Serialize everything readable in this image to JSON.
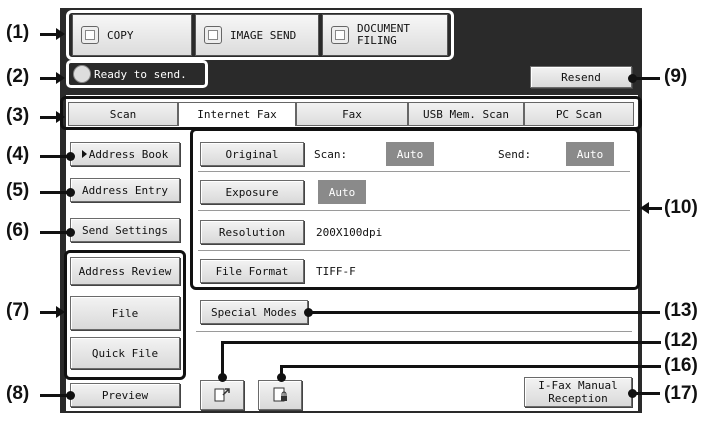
{
  "callouts": [
    "(1)",
    "(2)",
    "(3)",
    "(4)",
    "(5)",
    "(6)",
    "(7)",
    "(8)",
    "(9)",
    "(10)",
    "(13)",
    "(12)",
    "(16)",
    "(17)"
  ],
  "modes": [
    {
      "label": "COPY",
      "icon": "copy-icon"
    },
    {
      "label": "IMAGE SEND",
      "icon": "image-send-icon"
    },
    {
      "label": "DOCUMENT\nFILING",
      "icon": "document-filing-icon"
    }
  ],
  "status": {
    "text": "Ready to send.",
    "icon": "status-icon"
  },
  "resend_label": "Resend",
  "tabs": [
    "Scan",
    "Internet Fax",
    "Fax",
    "USB Mem. Scan",
    "PC Scan"
  ],
  "active_tab": "Internet Fax",
  "left_buttons": {
    "address_book": "Address Book",
    "address_entry": "Address Entry",
    "send_settings": "Send Settings",
    "address_review": "Address Review",
    "file": "File",
    "quick_file": "Quick File",
    "preview": "Preview"
  },
  "settings": {
    "original_label": "Original",
    "scan_label": "Scan:",
    "scan_value": "Auto",
    "send_label": "Send:",
    "send_value": "Auto",
    "exposure_label": "Exposure",
    "exposure_value": "Auto",
    "resolution_label": "Resolution",
    "resolution_value": "200X100dpi",
    "file_format_label": "File Format",
    "file_format_value": "TIFF-F"
  },
  "special_modes_label": "Special Modes",
  "ifax_manual_label": "I-Fax Manual\nReception",
  "colors": {
    "screen_bg": "#2a2a2a",
    "value_bg": "#8a8a8a",
    "callout_line": "#111111"
  }
}
